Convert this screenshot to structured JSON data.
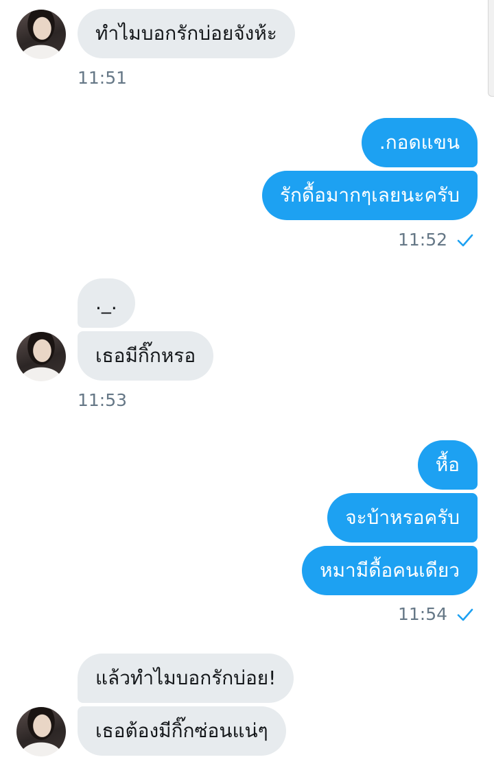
{
  "colors": {
    "incoming_bubble": "#e7ebee",
    "outgoing_bubble": "#1da1f2",
    "timestamp": "#657786",
    "read_check": "#1da1f2"
  },
  "messages": [
    {
      "direction": "incoming",
      "text": "ทำไมบอกรักบ่อยจังห้ะ"
    },
    {
      "direction": "outgoing",
      "text": ".กอดแขน"
    },
    {
      "direction": "outgoing",
      "text": "รักดื้อมากๆเลยนะครับ"
    },
    {
      "direction": "incoming",
      "text": "._."
    },
    {
      "direction": "incoming",
      "text": "เธอมีกิ๊กหรอ"
    },
    {
      "direction": "outgoing",
      "text": "หื้อ"
    },
    {
      "direction": "outgoing",
      "text": "จะบ้าหรอครับ"
    },
    {
      "direction": "outgoing",
      "text": "หมามีดื้อคนเดียว"
    },
    {
      "direction": "incoming",
      "text": "แล้วทำไมบอกรักบ่อย!"
    },
    {
      "direction": "incoming",
      "text": "เธอต้องมีกิ๊กซ่อนแน่ๆ"
    }
  ],
  "timestamps": [
    {
      "direction": "incoming",
      "time": "11:51"
    },
    {
      "direction": "outgoing",
      "time": "11:52",
      "read_icon": "check-icon"
    },
    {
      "direction": "incoming",
      "time": "11:53"
    },
    {
      "direction": "outgoing",
      "time": "11:54",
      "read_icon": "check-icon"
    }
  ]
}
